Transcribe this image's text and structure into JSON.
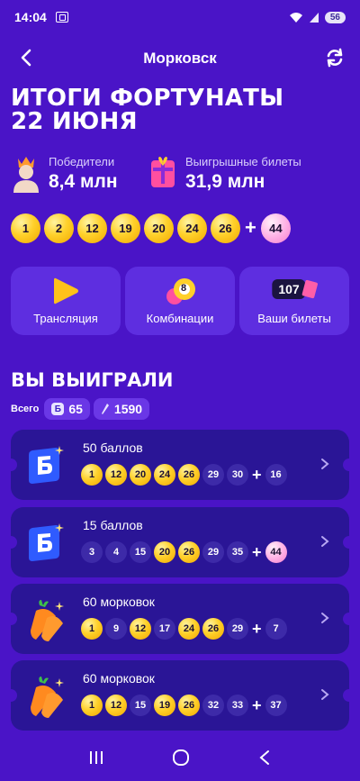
{
  "status": {
    "time": "14:04",
    "battery": "56"
  },
  "header": {
    "title": "Морковск"
  },
  "main": {
    "title_line1": "ИТОГИ ФОРТУНАТЫ",
    "title_line2": "22 ИЮНЯ"
  },
  "stats": {
    "winners_label": "Победители",
    "winners_value": "8,4 млн",
    "tickets_label": "Выигрышные билеты",
    "tickets_value": "31,9 млн"
  },
  "draw": {
    "numbers": [
      "1",
      "2",
      "12",
      "19",
      "20",
      "24",
      "26"
    ],
    "plus": "+",
    "extra": "44"
  },
  "actions": {
    "broadcast": "Трансляция",
    "combinations": "Комбинации",
    "my_tickets": "Ваши билеты",
    "my_tickets_count": "107",
    "combo_ball": "8"
  },
  "won": {
    "title": "ВЫ ВЫИГРАЛИ",
    "total_label": "Всего",
    "points": "65",
    "carrots": "1590",
    "points_icon": "Б"
  },
  "tickets": [
    {
      "icon": "points-badge-icon",
      "title": "50 баллов",
      "balls": [
        {
          "n": "1",
          "hit": true
        },
        {
          "n": "12",
          "hit": true
        },
        {
          "n": "20",
          "hit": true
        },
        {
          "n": "24",
          "hit": true
        },
        {
          "n": "26",
          "hit": true
        },
        {
          "n": "29",
          "hit": false
        },
        {
          "n": "30",
          "hit": false
        }
      ],
      "extra": {
        "n": "16",
        "hit": false
      }
    },
    {
      "icon": "points-badge-icon",
      "title": "15 баллов",
      "balls": [
        {
          "n": "3",
          "hit": false
        },
        {
          "n": "4",
          "hit": false
        },
        {
          "n": "15",
          "hit": false
        },
        {
          "n": "20",
          "hit": true
        },
        {
          "n": "26",
          "hit": true
        },
        {
          "n": "29",
          "hit": false
        },
        {
          "n": "35",
          "hit": false
        }
      ],
      "extra": {
        "n": "44",
        "hit": true
      }
    },
    {
      "icon": "carrot-icon",
      "title": "60 морковок",
      "balls": [
        {
          "n": "1",
          "hit": true
        },
        {
          "n": "9",
          "hit": false
        },
        {
          "n": "12",
          "hit": true
        },
        {
          "n": "17",
          "hit": false
        },
        {
          "n": "24",
          "hit": true
        },
        {
          "n": "26",
          "hit": true
        },
        {
          "n": "29",
          "hit": false
        }
      ],
      "extra": {
        "n": "7",
        "hit": false
      }
    },
    {
      "icon": "carrot-icon",
      "title": "60 морковок",
      "balls": [
        {
          "n": "1",
          "hit": true
        },
        {
          "n": "12",
          "hit": true
        },
        {
          "n": "15",
          "hit": false
        },
        {
          "n": "19",
          "hit": true
        },
        {
          "n": "26",
          "hit": true
        },
        {
          "n": "32",
          "hit": false
        },
        {
          "n": "33",
          "hit": false
        }
      ],
      "extra": {
        "n": "37",
        "hit": false
      }
    }
  ],
  "colors": {
    "background": "#4a14c7",
    "card": "#5e2ee0",
    "ticket": "#2a1596",
    "ball_hit": "#ffd02a",
    "ball_extra": "#ffb3e6"
  }
}
